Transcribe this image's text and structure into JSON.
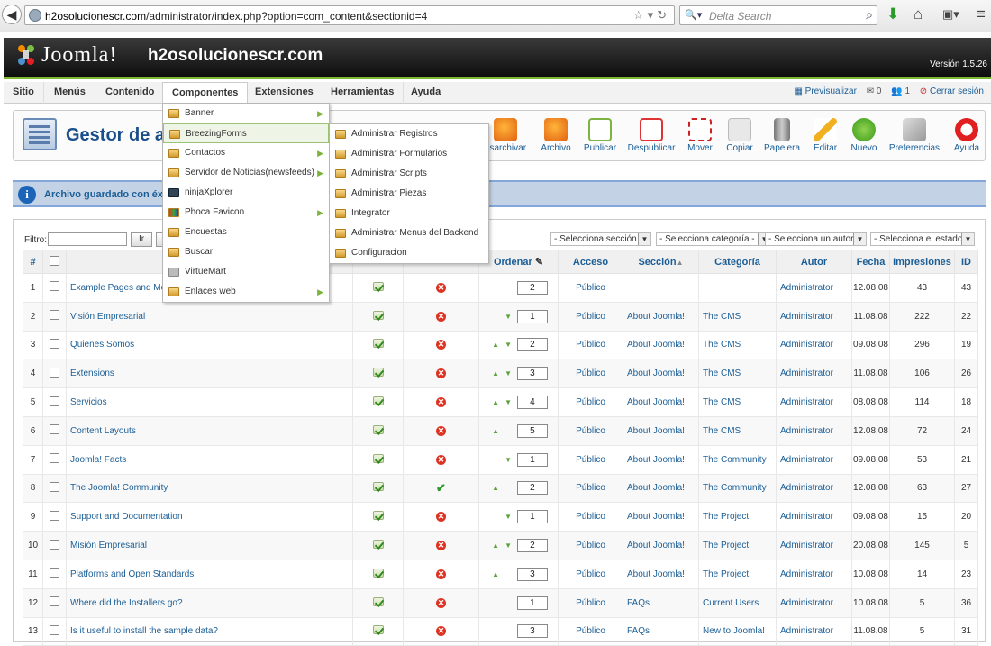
{
  "browser": {
    "url_domain": "h2osolucionescr.com",
    "url_path": "/administrator/index.php?option=com_content&sectionid=4",
    "search_placeholder": "Delta Search"
  },
  "header": {
    "logo_text": "Joomla!",
    "site_name": "h2osolucionescr.com",
    "version": "Versión 1.5.26"
  },
  "menubar": {
    "items": [
      "Sitio",
      "Menús",
      "Contenido",
      "Componentes",
      "Extensiones",
      "Herramientas",
      "Ayuda"
    ],
    "preview": "Previsualizar",
    "messages_count": "0",
    "users_count": "1",
    "logout": "Cerrar sesión"
  },
  "page": {
    "title": "Gestor de ar"
  },
  "toolbar": [
    "esarchivar",
    "Archivo",
    "Publicar",
    "Despublicar",
    "Mover",
    "Copiar",
    "Papelera",
    "Editar",
    "Nuevo",
    "Preferencias",
    "Ayuda"
  ],
  "message": "Archivo guardado con éxito",
  "filter": {
    "label": "Filtro:",
    "go": "Ir",
    "section": "- Selecciona sección -",
    "category": "- Selecciona categoría -",
    "author": "- Selecciona un autor -",
    "state": "- Selecciona el estado -"
  },
  "table": {
    "headers": [
      "#",
      "",
      "",
      "",
      "",
      "Ordenar",
      "Acceso",
      "Sección",
      "Categoría",
      "Autor",
      "Fecha",
      "Impresiones",
      "ID"
    ],
    "rows": [
      [
        "1",
        "Example Pages and Menu",
        "no",
        "2",
        "Público",
        "",
        "",
        "Administrator",
        "12.08.08",
        "43",
        "43",
        0,
        0
      ],
      [
        "2",
        "Visión Empresarial",
        "no",
        "1",
        "Público",
        "About Joomla!",
        "The CMS",
        "Administrator",
        "11.08.08",
        "222",
        "22",
        0,
        1
      ],
      [
        "3",
        "Quienes Somos",
        "no",
        "2",
        "Público",
        "About Joomla!",
        "The CMS",
        "Administrator",
        "09.08.08",
        "296",
        "19",
        1,
        1
      ],
      [
        "4",
        "Extensions",
        "no",
        "3",
        "Público",
        "About Joomla!",
        "The CMS",
        "Administrator",
        "11.08.08",
        "106",
        "26",
        1,
        1
      ],
      [
        "5",
        "Servicios",
        "no",
        "4",
        "Público",
        "About Joomla!",
        "The CMS",
        "Administrator",
        "08.08.08",
        "114",
        "18",
        1,
        1
      ],
      [
        "6",
        "Content Layouts",
        "no",
        "5",
        "Público",
        "About Joomla!",
        "The CMS",
        "Administrator",
        "12.08.08",
        "72",
        "24",
        1,
        0
      ],
      [
        "7",
        "Joomla! Facts",
        "no",
        "1",
        "Público",
        "About Joomla!",
        "The Community",
        "Administrator",
        "09.08.08",
        "53",
        "21",
        0,
        1
      ],
      [
        "8",
        "The Joomla! Community",
        "yes",
        "2",
        "Público",
        "About Joomla!",
        "The Community",
        "Administrator",
        "12.08.08",
        "63",
        "27",
        1,
        0
      ],
      [
        "9",
        "Support and Documentation",
        "no",
        "1",
        "Público",
        "About Joomla!",
        "The Project",
        "Administrator",
        "09.08.08",
        "15",
        "20",
        0,
        1
      ],
      [
        "10",
        "Misión Empresarial",
        "no",
        "2",
        "Público",
        "About Joomla!",
        "The Project",
        "Administrator",
        "20.08.08",
        "145",
        "5",
        1,
        1
      ],
      [
        "11",
        "Platforms and Open Standards",
        "no",
        "3",
        "Público",
        "About Joomla!",
        "The Project",
        "Administrator",
        "10.08.08",
        "14",
        "23",
        1,
        0
      ],
      [
        "12",
        "Where did the Installers go?",
        "no",
        "1",
        "Público",
        "FAQs",
        "Current Users",
        "Administrator",
        "10.08.08",
        "5",
        "36",
        0,
        0
      ],
      [
        "13",
        "Is it useful to install the sample data?",
        "no",
        "3",
        "Público",
        "FAQs",
        "New to Joomla!",
        "Administrator",
        "11.08.08",
        "5",
        "31",
        0,
        0
      ]
    ]
  },
  "components_menu": [
    "Banner",
    "BreezingForms",
    "Contactos",
    "Servidor de Noticias(newsfeeds)",
    "ninjaXplorer",
    "Phoca Favicon",
    "Encuestas",
    "Buscar",
    "VirtueMart",
    "Enlaces web"
  ],
  "breezing_submenu": [
    "Administrar Registros",
    "Administrar Formularios",
    "Administrar Scripts",
    "Administrar Piezas",
    "Integrator",
    "Administrar Menus del Backend",
    "Configuracion"
  ]
}
